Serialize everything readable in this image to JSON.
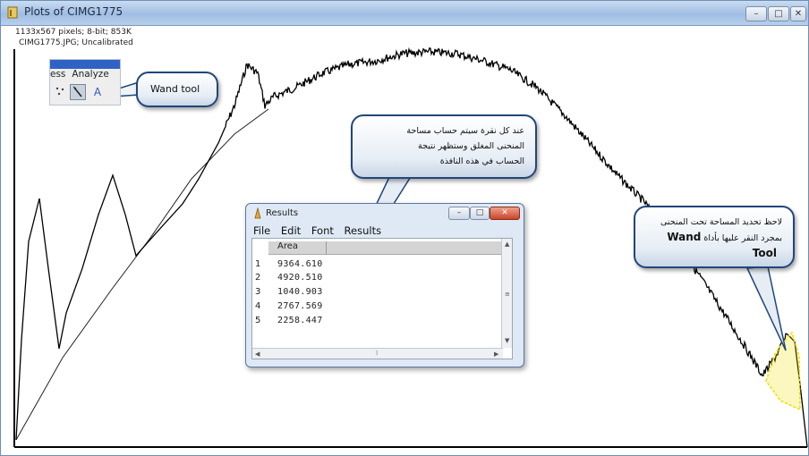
{
  "window": {
    "title": "Plots of CIMG1775",
    "info_line1": "1133x567 pixels; 8-bit; 853K",
    "info_line2": "CIMG1775.JPG; Uncalibrated",
    "minimize": "–",
    "maximize": "□",
    "close": "✕"
  },
  "toolbar": {
    "menu_items": [
      "ess",
      "Analyze"
    ],
    "text_tool": "A"
  },
  "callouts": {
    "wand_tool": "Wand tool",
    "arabic_results": [
      "عند كل نقرة سيتم حساب مساحة",
      "المنحنى المغلق وستظهر نتيجة",
      "الحساب في هذه النافذة"
    ],
    "arabic_wand_line1": "لاحظ تحديد المساحة تحت المنحنى",
    "arabic_wand_line2": "بمجرد النقر عليها بأداة",
    "arabic_wand_label": "Wand",
    "arabic_wand_line3": "Tool"
  },
  "results": {
    "title": "Results",
    "menu": [
      "File",
      "Edit",
      "Font",
      "Results"
    ],
    "column_header": "Area",
    "rows": [
      {
        "index": "1",
        "area": "9364.610"
      },
      {
        "index": "2",
        "area": "4920.510"
      },
      {
        "index": "3",
        "area": "1040.903"
      },
      {
        "index": "4",
        "area": "2767.569"
      },
      {
        "index": "5",
        "area": "2258.447"
      }
    ]
  },
  "colors": {
    "title_bar": "#9fbde2",
    "callout_border": "#21467a",
    "selection_yellow": "#f0e000",
    "plot_line": "#000000"
  }
}
